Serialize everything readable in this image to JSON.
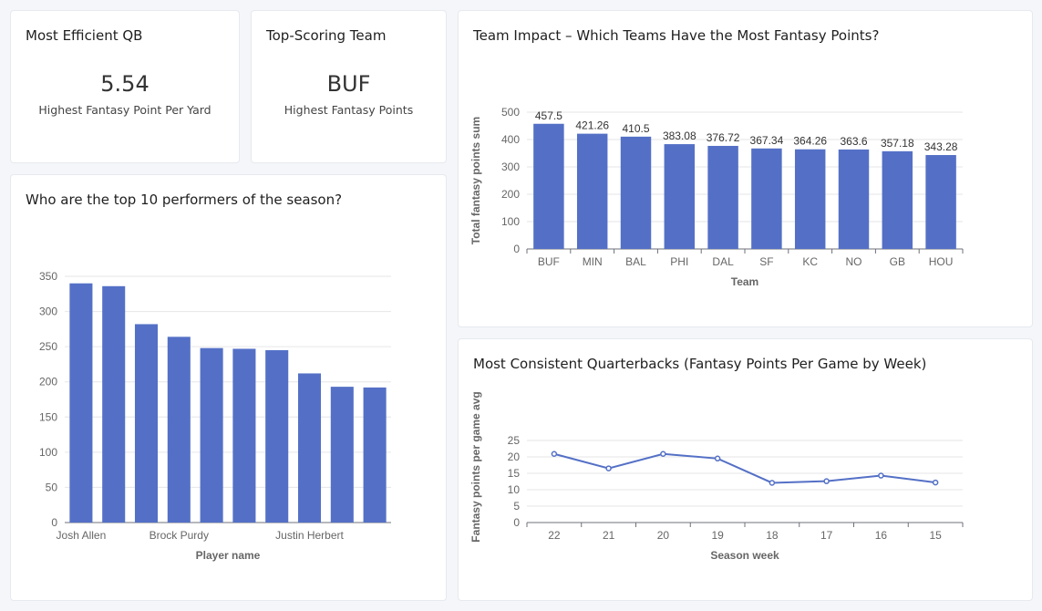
{
  "kpi_cards": [
    {
      "title": "Most Efficient QB",
      "value": "5.54",
      "subtitle": "Highest Fantasy Point Per Yard"
    },
    {
      "title": "Top-Scoring Team",
      "value": "BUF",
      "subtitle": "Highest Fantasy Points"
    }
  ],
  "colors": {
    "bar": "#5470c6",
    "grid": "#e6e6e6",
    "axis": "#6e7079"
  },
  "chart_data": [
    {
      "id": "top_performers",
      "type": "bar",
      "title": "Who are the top 10 performers of the season?",
      "xlabel": "Player name",
      "ylabel": "",
      "categories": [
        "Josh Allen",
        "",
        "",
        "Brock Purdy",
        "",
        "",
        "",
        "Justin Herbert",
        "",
        ""
      ],
      "values": [
        340,
        336,
        282,
        264,
        248,
        247,
        245,
        212,
        193,
        192
      ],
      "ylim": [
        0,
        350
      ],
      "yticks": [
        0,
        50,
        100,
        150,
        200,
        250,
        300,
        350
      ]
    },
    {
      "id": "team_impact",
      "type": "bar",
      "title": "Team Impact – Which Teams Have the Most Fantasy Points?",
      "xlabel": "Team",
      "ylabel": "Total fantasy points sum",
      "categories": [
        "BUF",
        "MIN",
        "BAL",
        "PHI",
        "DAL",
        "SF",
        "KC",
        "NO",
        "GB",
        "HOU"
      ],
      "values": [
        457.5,
        421.26,
        410.5,
        383.08,
        376.72,
        367.34,
        364.26,
        363.6,
        357.18,
        343.28
      ],
      "data_labels": [
        "457.5",
        "421.26",
        "410.5",
        "383.08",
        "376.72",
        "367.34",
        "364.26",
        "363.6",
        "357.18",
        "343.28"
      ],
      "ylim": [
        0,
        500
      ],
      "yticks": [
        0,
        100,
        200,
        300,
        400,
        500
      ]
    },
    {
      "id": "consistent_qbs",
      "type": "line",
      "title": "Most Consistent Quarterbacks (Fantasy Points Per Game by Week)",
      "xlabel": "Season week",
      "ylabel": "Fantasy points per game avg",
      "categories": [
        "22",
        "21",
        "20",
        "19",
        "18",
        "17",
        "16",
        "15"
      ],
      "values": [
        20.9,
        16.5,
        20.9,
        19.5,
        12.1,
        12.6,
        14.3,
        12.2
      ],
      "ylim": [
        0,
        25
      ],
      "yticks": [
        0,
        5,
        10,
        15,
        20,
        25
      ]
    }
  ]
}
